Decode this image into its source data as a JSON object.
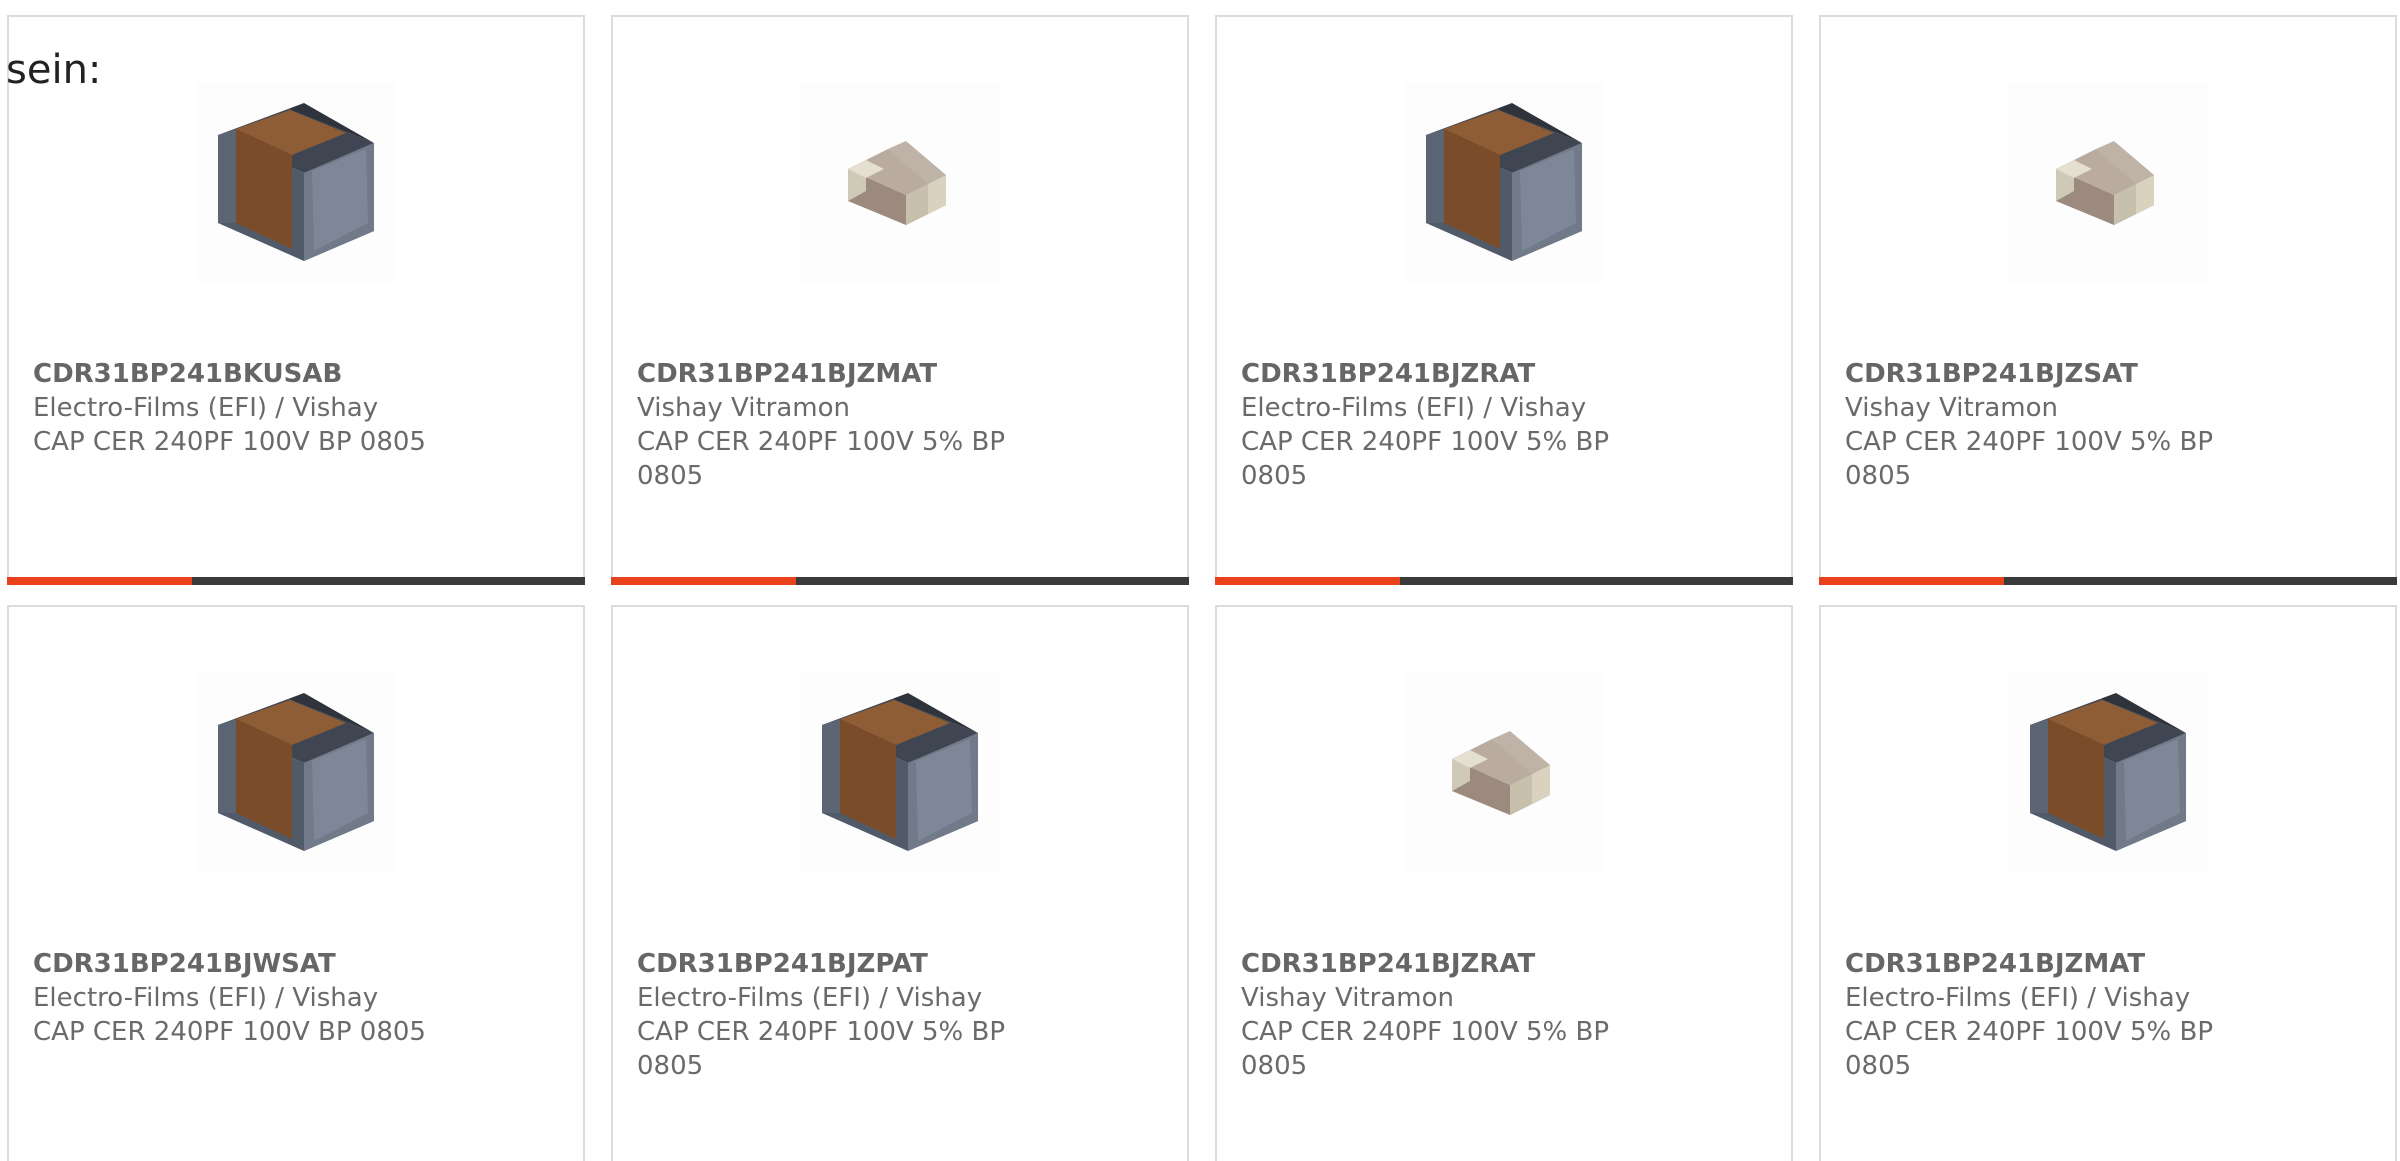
{
  "intro_text": "sein:",
  "colors": {
    "accent": "#e8411c",
    "bar_track": "#3a3a3a",
    "border": "#dcdcdc",
    "text": "#6a6a6a"
  },
  "products": [
    {
      "part_number": "CDR31BP241BKUSAB",
      "manufacturer": "Electro-Films (EFI) / Vishay",
      "description": "CAP CER 240PF 100V BP 0805",
      "image": "large-capacitor-icon",
      "accent_fill": 0.32
    },
    {
      "part_number": "CDR31BP241BJZMAT",
      "manufacturer": "Vishay Vitramon",
      "description": "CAP CER 240PF 100V 5% BP 0805",
      "image": "small-capacitor-icon",
      "accent_fill": 0.32
    },
    {
      "part_number": "CDR31BP241BJZRAT",
      "manufacturer": "Electro-Films (EFI) / Vishay",
      "description": "CAP CER 240PF 100V 5% BP 0805",
      "image": "large-capacitor-icon",
      "accent_fill": 0.32
    },
    {
      "part_number": "CDR31BP241BJZSAT",
      "manufacturer": "Vishay Vitramon",
      "description": "CAP CER 240PF 100V 5% BP 0805",
      "image": "small-capacitor-icon",
      "accent_fill": 0.32
    },
    {
      "part_number": "CDR31BP241BJWSAT",
      "manufacturer": "Electro-Films (EFI) / Vishay",
      "description": "CAP CER 240PF 100V BP 0805",
      "image": "large-capacitor-icon"
    },
    {
      "part_number": "CDR31BP241BJZPAT",
      "manufacturer": "Electro-Films (EFI) / Vishay",
      "description": "CAP CER 240PF 100V 5% BP 0805",
      "image": "large-capacitor-icon"
    },
    {
      "part_number": "CDR31BP241BJZRAT",
      "manufacturer": "Vishay Vitramon",
      "description": "CAP CER 240PF 100V 5% BP 0805",
      "image": "small-capacitor-icon"
    },
    {
      "part_number": "CDR31BP241BJZMAT",
      "manufacturer": "Electro-Films (EFI) / Vishay",
      "description": "CAP CER 240PF 100V 5% BP 0805",
      "image": "large-capacitor-icon"
    }
  ]
}
